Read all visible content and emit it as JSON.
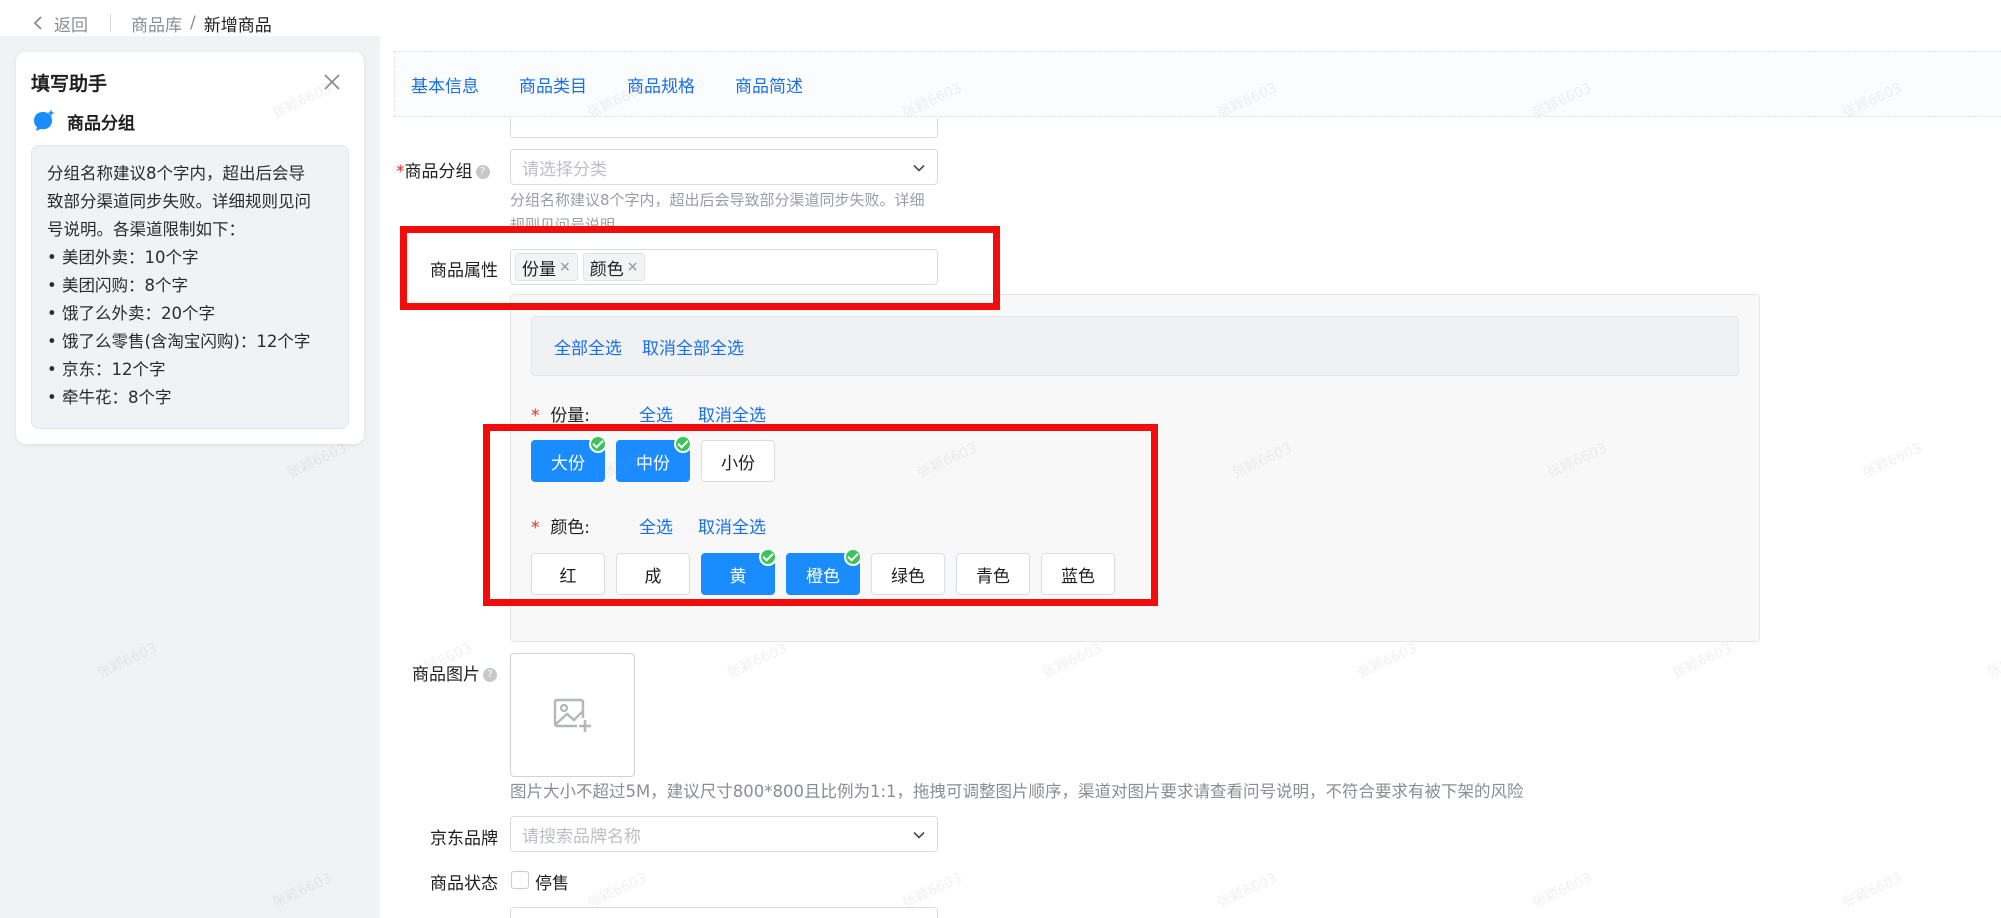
{
  "breadcrumb": {
    "back_label": "返回",
    "parent": "商品库",
    "separator": "/",
    "current": "新增商品"
  },
  "helper": {
    "title": "填写助手",
    "section_title": "商品分组",
    "lines": [
      "分组名称建议8个字内，超出后会导",
      "致部分渠道同步失败。详细规则见问",
      "号说明。各渠道限制如下：",
      "• 美团外卖：10个字",
      "• 美团闪购：8个字",
      "• 饿了么外卖：20个字",
      "• 饿了么零售(含淘宝闪购)：12个字",
      "• 京东：12个字",
      "• 牵牛花：8个字"
    ]
  },
  "tabs": [
    "基本信息",
    "商品类目",
    "商品规格",
    "商品简述"
  ],
  "form": {
    "group": {
      "required_mark": "*",
      "label": "商品分组",
      "help": "?",
      "placeholder": "请选择分类",
      "hint_line1": "分组名称建议8个字内，超出后会导致部分渠道同步失败。详细",
      "hint_line2": "规则见问号说明"
    },
    "attrs": {
      "label": "商品属性",
      "tags": [
        "份量",
        "颜色"
      ],
      "tag_close": "×"
    },
    "spec": {
      "select_all_global": "全部全选",
      "deselect_all_global": "取消全部全选",
      "groups": [
        {
          "required_mark": "*",
          "label": "份量:",
          "select_all": "全选",
          "deselect_all": "取消全选",
          "options": [
            {
              "label": "大份",
              "selected": true
            },
            {
              "label": "中份",
              "selected": true
            },
            {
              "label": "小份",
              "selected": false
            }
          ]
        },
        {
          "required_mark": "*",
          "label": "颜色:",
          "select_all": "全选",
          "deselect_all": "取消全选",
          "options": [
            {
              "label": "红",
              "selected": false
            },
            {
              "label": "成",
              "selected": false
            },
            {
              "label": "黄",
              "selected": true
            },
            {
              "label": "橙色",
              "selected": true
            },
            {
              "label": "绿色",
              "selected": false
            },
            {
              "label": "青色",
              "selected": false
            },
            {
              "label": "蓝色",
              "selected": false
            }
          ]
        }
      ]
    },
    "image": {
      "label": "商品图片",
      "help": "?",
      "hint": "图片大小不超过5M，建议尺寸800*800且比例为1:1，拖拽可调整图片顺序，渠道对图片要求请查看问号说明，不符合要求有被下架的风险"
    },
    "jd_brand": {
      "label": "京东品牌",
      "placeholder": "请搜索品牌名称"
    },
    "status": {
      "label": "商品状态",
      "checkbox_label": "停售",
      "checked": false
    }
  },
  "watermark": "张颖6603",
  "colors": {
    "accent": "#1a8cff",
    "link": "#1a6fe6",
    "highlight": "#f20c0c",
    "check": "#3cc45b"
  }
}
